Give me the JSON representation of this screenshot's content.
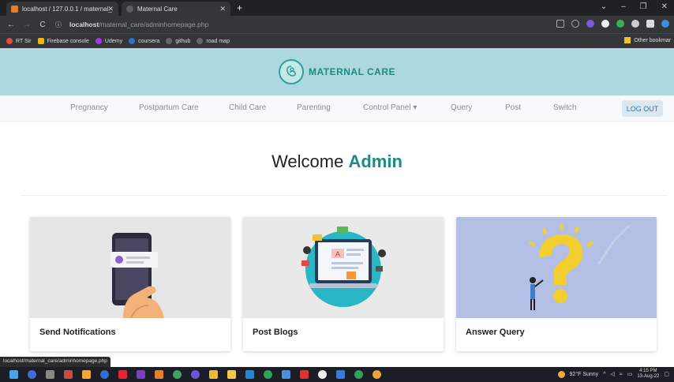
{
  "browser": {
    "tabs": [
      {
        "label": "localhost / 127.0.0.1 / maternal_"
      },
      {
        "label": "Maternal Care"
      }
    ],
    "url_host": "localhost",
    "url_path": "/maternal_care/adminhomepage.php",
    "bookmarks": [
      "RT Sir",
      "Firebase console",
      "Udemy",
      "coursera",
      "github",
      "road map"
    ],
    "other_bookmarks": "Other bookmar"
  },
  "header": {
    "brand": "MATERNAL CARE"
  },
  "nav": {
    "items": [
      "Pregnancy",
      "Postpartum Care",
      "Child Care",
      "Parenting",
      "Control Panel ▾",
      "Query",
      "Post",
      "Switch"
    ],
    "logout": "LOG OUT"
  },
  "welcome": {
    "text": "Welcome ",
    "name": "Admin"
  },
  "cards": [
    {
      "title": "Send Notifications"
    },
    {
      "title": "Post Blogs"
    },
    {
      "title": "Answer Query"
    }
  ],
  "status_url": "localhost/maternal_care/adminhomepage.php",
  "taskbar": {
    "weather": "92°F Sunny",
    "time": "4:15 PM",
    "date": "13-Aug-22"
  },
  "colors": {
    "header_bg": "#add8e0",
    "brand": "#1d8a82",
    "admin": "#1e8a86"
  }
}
